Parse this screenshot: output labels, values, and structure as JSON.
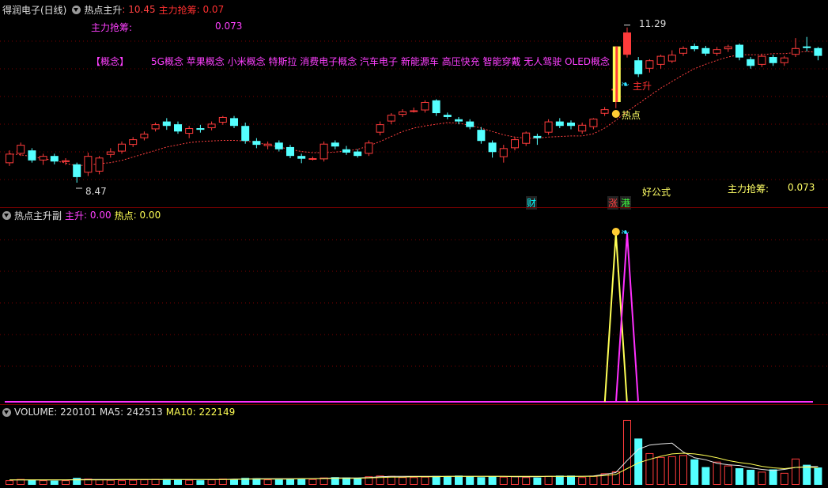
{
  "main": {
    "title": "得润电子(日线)",
    "indicator": "热点主升",
    "indicator_value": ": 10.45",
    "zlqc_label": "主力抢筹",
    "zlqc_value": ": 0.07",
    "row2_label": "主力抢筹:",
    "row2_value": "0.073",
    "concept_tag": "【概念】",
    "concepts": "5G概念 苹果概念 小米概念 特斯拉 消费电子概念 汽车电子 新能源车 高压快充 智能穿戴 无人驾驶 OLED概念",
    "high_price": "11.29",
    "low_price": "8.47",
    "marker_hot": "热点",
    "marker_main": "主升",
    "badge_cai": "财",
    "badge_zhang": "涨",
    "badge_gang": "港",
    "good_formula": "好公式",
    "br_label": "主力抢筹:",
    "br_value": "0.073"
  },
  "sub": {
    "title": "热点主升副",
    "zs_label": "主升",
    "zs_value": ": 0.00",
    "rd_label": "热点",
    "rd_value": ": 0.00"
  },
  "vol": {
    "title": "VOLUME: 220101",
    "ma5": "MA5: 242513",
    "ma10": "MA10: 222149"
  },
  "colors": {
    "up": "#ff3b3b",
    "down": "#54ffff",
    "magenta": "#ff30ff",
    "yellow": "#ffff55",
    "grid": "#7a0000"
  },
  "chart_data": {
    "type": "candlestick",
    "price_high": 11.29,
    "price_low": 8.47,
    "candles": [
      {
        "o": 8.85,
        "c": 9.02,
        "h": 9.08,
        "l": 8.8
      },
      {
        "o": 9.02,
        "c": 9.18,
        "h": 9.22,
        "l": 8.98
      },
      {
        "o": 9.08,
        "c": 8.9,
        "h": 9.12,
        "l": 8.86
      },
      {
        "o": 8.9,
        "c": 8.98,
        "h": 9.02,
        "l": 8.82
      },
      {
        "o": 8.98,
        "c": 8.88,
        "h": 9.02,
        "l": 8.83
      },
      {
        "o": 8.88,
        "c": 8.9,
        "h": 8.94,
        "l": 8.82
      },
      {
        "o": 8.83,
        "c": 8.6,
        "h": 8.86,
        "l": 8.5
      },
      {
        "o": 8.68,
        "c": 8.98,
        "h": 9.04,
        "l": 8.62
      },
      {
        "o": 8.7,
        "c": 8.95,
        "h": 8.98,
        "l": 8.65
      },
      {
        "o": 9.0,
        "c": 9.06,
        "h": 9.12,
        "l": 8.95
      },
      {
        "o": 9.06,
        "c": 9.2,
        "h": 9.24,
        "l": 9.02
      },
      {
        "o": 9.18,
        "c": 9.28,
        "h": 9.32,
        "l": 9.14
      },
      {
        "o": 9.3,
        "c": 9.38,
        "h": 9.42,
        "l": 9.26
      },
      {
        "o": 9.46,
        "c": 9.55,
        "h": 9.58,
        "l": 9.42
      },
      {
        "o": 9.6,
        "c": 9.52,
        "h": 9.66,
        "l": 9.45
      },
      {
        "o": 9.55,
        "c": 9.42,
        "h": 9.6,
        "l": 9.38
      },
      {
        "o": 9.38,
        "c": 9.48,
        "h": 9.52,
        "l": 9.3
      },
      {
        "o": 9.48,
        "c": 9.45,
        "h": 9.54,
        "l": 9.4
      },
      {
        "o": 9.48,
        "c": 9.56,
        "h": 9.6,
        "l": 9.44
      },
      {
        "o": 9.58,
        "c": 9.68,
        "h": 9.7,
        "l": 9.54
      },
      {
        "o": 9.66,
        "c": 9.52,
        "h": 9.7,
        "l": 9.48
      },
      {
        "o": 9.52,
        "c": 9.25,
        "h": 9.58,
        "l": 9.2
      },
      {
        "o": 9.25,
        "c": 9.18,
        "h": 9.3,
        "l": 9.12
      },
      {
        "o": 9.16,
        "c": 9.2,
        "h": 9.24,
        "l": 9.1
      },
      {
        "o": 9.22,
        "c": 9.1,
        "h": 9.26,
        "l": 9.06
      },
      {
        "o": 9.14,
        "c": 8.98,
        "h": 9.18,
        "l": 8.94
      },
      {
        "o": 8.98,
        "c": 8.93,
        "h": 9.02,
        "l": 8.85
      },
      {
        "o": 8.93,
        "c": 8.94,
        "h": 8.97,
        "l": 8.9
      },
      {
        "o": 8.92,
        "c": 9.2,
        "h": 9.24,
        "l": 8.88
      },
      {
        "o": 9.22,
        "c": 9.15,
        "h": 9.26,
        "l": 9.1
      },
      {
        "o": 9.1,
        "c": 9.04,
        "h": 9.16,
        "l": 9.0
      },
      {
        "o": 9.06,
        "c": 8.98,
        "h": 9.1,
        "l": 8.95
      },
      {
        "o": 9.02,
        "c": 9.22,
        "h": 9.26,
        "l": 8.98
      },
      {
        "o": 9.4,
        "c": 9.55,
        "h": 9.6,
        "l": 9.35
      },
      {
        "o": 9.6,
        "c": 9.72,
        "h": 9.75,
        "l": 9.55
      },
      {
        "o": 9.72,
        "c": 9.78,
        "h": 9.82,
        "l": 9.68
      },
      {
        "o": 9.8,
        "c": 9.8,
        "h": 9.85,
        "l": 9.76
      },
      {
        "o": 9.8,
        "c": 9.95,
        "h": 9.98,
        "l": 9.76
      },
      {
        "o": 9.98,
        "c": 9.75,
        "h": 10.0,
        "l": 9.7
      },
      {
        "o": 9.72,
        "c": 9.68,
        "h": 9.76,
        "l": 9.64
      },
      {
        "o": 9.64,
        "c": 9.6,
        "h": 9.68,
        "l": 9.55
      },
      {
        "o": 9.6,
        "c": 9.5,
        "h": 9.64,
        "l": 9.46
      },
      {
        "o": 9.45,
        "c": 9.25,
        "h": 9.5,
        "l": 9.2
      },
      {
        "o": 9.22,
        "c": 9.05,
        "h": 9.26,
        "l": 8.95
      },
      {
        "o": 8.96,
        "c": 9.12,
        "h": 9.18,
        "l": 8.86
      },
      {
        "o": 9.12,
        "c": 9.28,
        "h": 9.32,
        "l": 9.08
      },
      {
        "o": 9.2,
        "c": 9.4,
        "h": 9.42,
        "l": 9.16
      },
      {
        "o": 9.34,
        "c": 9.3,
        "h": 9.38,
        "l": 9.18
      },
      {
        "o": 9.4,
        "c": 9.6,
        "h": 9.64,
        "l": 9.36
      },
      {
        "o": 9.6,
        "c": 9.52,
        "h": 9.66,
        "l": 9.48
      },
      {
        "o": 9.58,
        "c": 9.52,
        "h": 9.62,
        "l": 9.46
      },
      {
        "o": 9.42,
        "c": 9.54,
        "h": 9.58,
        "l": 9.38
      },
      {
        "o": 9.5,
        "c": 9.65,
        "h": 9.66,
        "l": 9.46
      },
      {
        "o": 9.74,
        "c": 9.82,
        "h": 9.86,
        "l": 9.7
      },
      {
        "o": 10.18,
        "c": 10.18,
        "h": 10.2,
        "l": 9.84
      },
      {
        "o": 10.8,
        "c": 11.2,
        "h": 11.29,
        "l": 10.75
      },
      {
        "o": 10.7,
        "c": 10.45,
        "h": 10.76,
        "l": 10.4
      },
      {
        "o": 10.55,
        "c": 10.7,
        "h": 10.72,
        "l": 10.48
      },
      {
        "o": 10.62,
        "c": 10.78,
        "h": 10.8,
        "l": 10.55
      },
      {
        "o": 10.68,
        "c": 10.8,
        "h": 10.88,
        "l": 10.65
      },
      {
        "o": 10.82,
        "c": 10.92,
        "h": 10.95,
        "l": 10.78
      },
      {
        "o": 10.96,
        "c": 10.9,
        "h": 11.0,
        "l": 10.86
      },
      {
        "o": 10.92,
        "c": 10.82,
        "h": 10.96,
        "l": 10.78
      },
      {
        "o": 10.82,
        "c": 10.9,
        "h": 10.94,
        "l": 10.78
      },
      {
        "o": 10.9,
        "c": 10.95,
        "h": 10.98,
        "l": 10.85
      },
      {
        "o": 10.98,
        "c": 10.75,
        "h": 11.0,
        "l": 10.7
      },
      {
        "o": 10.72,
        "c": 10.6,
        "h": 10.76,
        "l": 10.55
      },
      {
        "o": 10.62,
        "c": 10.78,
        "h": 10.82,
        "l": 10.58
      },
      {
        "o": 10.76,
        "c": 10.65,
        "h": 10.8,
        "l": 10.6
      },
      {
        "o": 10.65,
        "c": 10.75,
        "h": 10.78,
        "l": 10.6
      },
      {
        "o": 10.8,
        "c": 10.92,
        "h": 11.1,
        "l": 10.76
      },
      {
        "o": 10.95,
        "c": 10.92,
        "h": 11.12,
        "l": 10.86
      },
      {
        "o": 10.92,
        "c": 10.78,
        "h": 10.94,
        "l": 10.7
      }
    ],
    "ma": [
      9.02,
      9.0,
      8.97,
      8.93,
      8.9,
      8.85,
      8.8,
      8.82,
      8.84,
      8.86,
      8.9,
      8.96,
      9.02,
      9.08,
      9.14,
      9.18,
      9.22,
      9.24,
      9.25,
      9.26,
      9.26,
      9.25,
      9.22,
      9.18,
      9.14,
      9.1,
      9.06,
      9.04,
      9.04,
      9.05,
      9.07,
      9.1,
      9.16,
      9.24,
      9.33,
      9.42,
      9.48,
      9.52,
      9.55,
      9.58,
      9.57,
      9.53,
      9.48,
      9.42,
      9.36,
      9.32,
      9.3,
      9.3,
      9.32,
      9.33,
      9.34,
      9.34,
      9.38,
      9.48,
      9.62,
      9.78,
      9.92,
      10.06,
      10.2,
      10.32,
      10.44,
      10.55,
      10.63,
      10.7,
      10.76,
      10.8,
      10.8,
      10.8,
      10.82,
      10.82,
      10.84,
      10.86,
      10.84
    ],
    "volume": [
      12,
      15,
      13,
      12,
      11,
      12,
      18,
      16,
      14,
      13,
      12,
      13,
      14,
      15,
      15,
      14,
      13,
      12,
      14,
      16,
      15,
      18,
      17,
      14,
      14,
      15,
      16,
      15,
      19,
      20,
      19,
      17,
      22,
      24,
      23,
      20,
      20,
      21,
      23,
      22,
      24,
      22,
      20,
      22,
      21,
      22,
      20,
      19,
      23,
      24,
      24,
      20,
      23,
      30,
      35,
      168,
      120,
      82,
      72,
      74,
      77,
      66,
      46,
      60,
      50,
      43,
      39,
      34,
      40,
      31,
      68,
      52,
      45
    ],
    "vol_ma5": [
      13,
      13,
      13,
      13,
      13,
      13,
      14,
      14,
      14,
      14,
      14,
      14,
      14,
      14,
      14,
      14,
      14,
      14,
      14,
      14,
      15,
      15,
      16,
      16,
      16,
      16,
      16,
      16,
      17,
      18,
      18,
      18,
      19,
      21,
      22,
      22,
      22,
      22,
      22,
      22,
      22,
      22,
      22,
      22,
      22,
      21,
      21,
      21,
      22,
      22,
      22,
      22,
      23,
      27,
      32,
      63,
      92,
      103,
      106,
      108,
      85,
      70,
      65,
      56,
      52,
      50,
      44,
      40,
      37,
      40,
      45,
      47,
      48
    ],
    "vol_ma10": [
      13,
      13,
      13,
      13,
      13,
      13,
      13,
      13,
      13,
      13,
      14,
      14,
      14,
      14,
      14,
      14,
      14,
      14,
      14,
      14,
      14,
      15,
      15,
      15,
      15,
      15,
      16,
      16,
      16,
      17,
      17,
      17,
      18,
      19,
      20,
      20,
      21,
      21,
      21,
      22,
      22,
      22,
      22,
      22,
      22,
      22,
      22,
      22,
      22,
      22,
      22,
      22,
      22,
      24,
      27,
      42,
      57,
      66,
      74,
      80,
      82,
      80,
      76,
      70,
      63,
      58,
      54,
      48,
      44,
      42,
      45,
      46,
      44
    ],
    "signal_hot_index": 54,
    "signal_main_index": 55
  }
}
